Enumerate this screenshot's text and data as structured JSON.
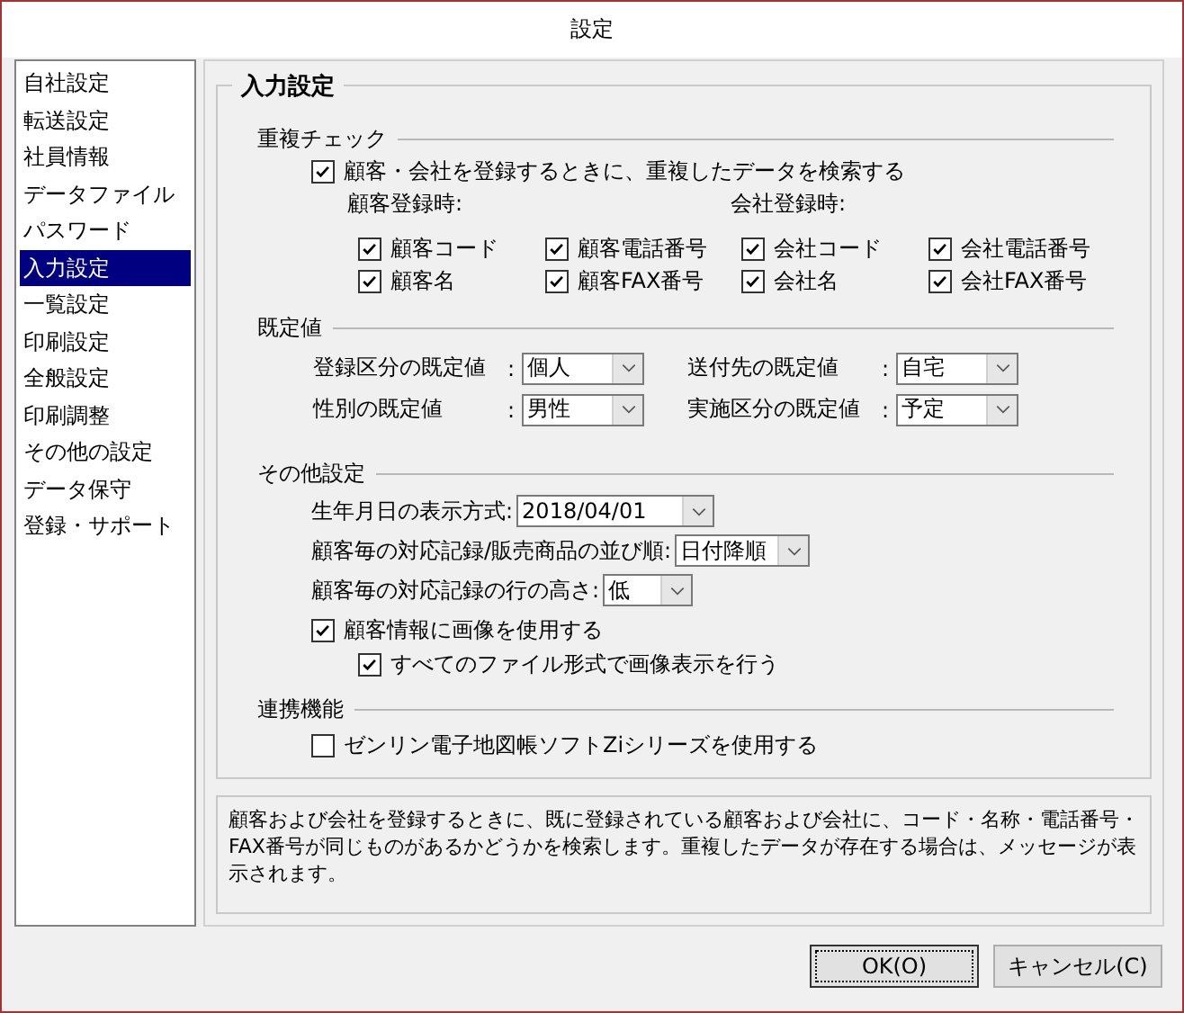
{
  "window": {
    "title": "設定"
  },
  "sidebar": {
    "items": [
      {
        "label": "自社設定",
        "selected": false
      },
      {
        "label": "転送設定",
        "selected": false
      },
      {
        "label": "社員情報",
        "selected": false
      },
      {
        "label": "データファイル",
        "selected": false
      },
      {
        "label": "パスワード",
        "selected": false
      },
      {
        "label": "入力設定",
        "selected": true
      },
      {
        "label": "一覧設定",
        "selected": false
      },
      {
        "label": "印刷設定",
        "selected": false
      },
      {
        "label": "全般設定",
        "selected": false
      },
      {
        "label": "印刷調整",
        "selected": false
      },
      {
        "label": "その他の設定",
        "selected": false
      },
      {
        "label": "データ保守",
        "selected": false
      },
      {
        "label": "登録・サポート",
        "selected": false
      }
    ]
  },
  "group": {
    "title": "入力設定",
    "duplicate_check": {
      "title": "重複チェック",
      "search": {
        "label": "顧客・会社を登録するときに、重複したデータを検索する",
        "checked": true
      },
      "groups": [
        {
          "heading": "顧客登録時:",
          "options": [
            {
              "label": "顧客コード",
              "checked": true
            },
            {
              "label": "顧客電話番号",
              "checked": true
            },
            {
              "label": "顧客名",
              "checked": true
            },
            {
              "label": "顧客FAX番号",
              "checked": true
            }
          ]
        },
        {
          "heading": "会社登録時:",
          "options": [
            {
              "label": "会社コード",
              "checked": true
            },
            {
              "label": "会社電話番号",
              "checked": true
            },
            {
              "label": "会社名",
              "checked": true
            },
            {
              "label": "会社FAX番号",
              "checked": true
            }
          ]
        }
      ]
    },
    "defaults": {
      "title": "既定値",
      "fields": [
        {
          "label": "登録区分の既定値",
          "colon": ":",
          "value": "個人"
        },
        {
          "label": "送付先の既定値",
          "colon": ":",
          "value": "自宅"
        },
        {
          "label": "性別の既定値",
          "colon": ":",
          "value": "男性"
        },
        {
          "label": "実施区分の既定値",
          "colon": ":",
          "value": "予定"
        }
      ]
    },
    "other": {
      "title": "その他設定",
      "dropdowns": [
        {
          "label": "生年月日の表示方式:",
          "value": "2018/04/01"
        },
        {
          "label": "顧客毎の対応記録/販売商品の並び順:",
          "value": "日付降順"
        },
        {
          "label": "顧客毎の対応記録の行の高さ:",
          "value": "低"
        }
      ],
      "options": [
        {
          "label": "顧客情報に画像を使用する",
          "checked": true,
          "children": [
            {
              "label": "すべてのファイル形式で画像表示を行う",
              "checked": true
            }
          ]
        }
      ]
    },
    "integration": {
      "title": "連携機能",
      "options": [
        {
          "label": "ゼンリン電子地図帳ソフトZiシリーズを使用する",
          "checked": false
        }
      ]
    }
  },
  "description": "顧客および会社を登録するときに、既に登録されている顧客および会社に、コード・名称・電話番号・FAX番号が同じものがあるかどうかを検索します。重複したデータが存在する場合は、メッセージが表示されます。",
  "buttons": [
    {
      "label": "OK(O)",
      "default": true
    },
    {
      "label": "キャンセル(C)",
      "default": false
    }
  ]
}
